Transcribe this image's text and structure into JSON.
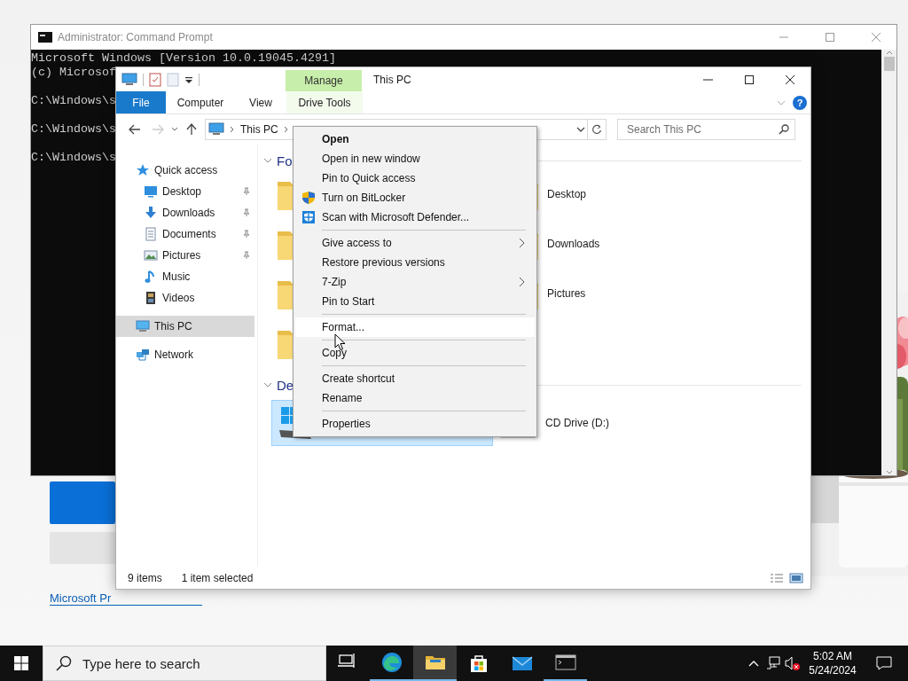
{
  "background_app": {
    "link": "Microsoft Pr"
  },
  "command_prompt": {
    "title": "Administrator: Command Prompt",
    "lines": [
      {
        "text": "Microsoft Windows [Version 10.0.19045.4291]",
        "blank_before": false
      },
      {
        "text": "(c) Microsof",
        "blank_before": false
      },
      {
        "text": "C:\\Windows\\s",
        "blank_before": true
      },
      {
        "text": "C:\\Windows\\s",
        "blank_before": true
      },
      {
        "text": "C:\\Windows\\s",
        "blank_before": true
      }
    ]
  },
  "explorer": {
    "context_tab": "Manage",
    "title": "This PC",
    "help": "?",
    "ribbon_tabs": [
      {
        "label": "File",
        "kind": "file"
      },
      {
        "label": "Computer",
        "kind": "tab"
      },
      {
        "label": "View",
        "kind": "tab"
      },
      {
        "label": "Drive Tools",
        "kind": "contextual"
      }
    ],
    "address": {
      "crumbs": [
        "This PC"
      ]
    },
    "search": {
      "placeholder": "Search This PC"
    },
    "navigation": [
      {
        "label": "Quick access",
        "selected": false,
        "children": [
          {
            "label": "Desktop",
            "pinned": true,
            "selected": false
          },
          {
            "label": "Downloads",
            "pinned": true,
            "selected": false
          },
          {
            "label": "Documents",
            "pinned": true,
            "selected": false
          },
          {
            "label": "Pictures",
            "pinned": true,
            "selected": false
          },
          {
            "label": "Music",
            "pinned": false,
            "selected": false
          },
          {
            "label": "Videos",
            "pinned": false,
            "selected": false
          }
        ]
      },
      {
        "label": "This PC",
        "selected": true
      },
      {
        "label": "Network",
        "selected": false
      }
    ],
    "groups": [
      {
        "header": "Fo",
        "expanded": true,
        "items": [
          {
            "kind": "folder",
            "selected": false
          },
          {
            "kind": "folder",
            "label": "Desktop",
            "selected": false
          },
          {
            "kind": "folder",
            "selected": false
          },
          {
            "kind": "folder",
            "label": "Downloads",
            "selected": false
          },
          {
            "kind": "folder",
            "selected": false
          },
          {
            "kind": "folder",
            "label": "Pictures",
            "selected": false
          },
          {
            "kind": "folder",
            "selected": false
          }
        ]
      },
      {
        "header": "De",
        "expanded": true,
        "items": [
          {
            "kind": "drive",
            "selected": true
          },
          {
            "kind": "drive",
            "label": "CD Drive (D:)",
            "selected": false
          }
        ]
      }
    ],
    "status_bar": {
      "item_count": "9 items",
      "selection": "1 item selected"
    }
  },
  "context_menu": {
    "sections": [
      [
        {
          "label": "Open",
          "default": true,
          "submenu": false,
          "hovered": false
        },
        {
          "label": "Open in new window",
          "default": false,
          "submenu": false,
          "hovered": false
        },
        {
          "label": "Pin to Quick access",
          "default": false,
          "submenu": false,
          "hovered": false
        },
        {
          "label": "Turn on BitLocker",
          "default": false,
          "submenu": false,
          "hovered": false
        },
        {
          "label": "Scan with Microsoft Defender...",
          "default": false,
          "submenu": false,
          "hovered": false
        }
      ],
      [
        {
          "label": "Give access to",
          "default": false,
          "submenu": true,
          "hovered": false
        },
        {
          "label": "Restore previous versions",
          "default": false,
          "submenu": false,
          "hovered": false
        },
        {
          "label": "7-Zip",
          "default": false,
          "submenu": true,
          "hovered": false
        },
        {
          "label": "Pin to Start",
          "default": false,
          "submenu": false,
          "hovered": false
        }
      ],
      [
        {
          "label": "Format...",
          "default": false,
          "submenu": false,
          "hovered": true
        }
      ],
      [
        {
          "label": "Copy",
          "default": false,
          "submenu": false,
          "hovered": false
        }
      ],
      [
        {
          "label": "Create shortcut",
          "default": false,
          "submenu": false,
          "hovered": false
        },
        {
          "label": "Rename",
          "default": false,
          "submenu": false,
          "hovered": false
        }
      ],
      [
        {
          "label": "Properties",
          "default": false,
          "submenu": false,
          "hovered": false
        }
      ]
    ]
  },
  "taskbar": {
    "search": {
      "placeholder": "Type here to search"
    },
    "apps": [
      {
        "running": false,
        "active": false
      },
      {
        "running": true,
        "active": false
      },
      {
        "running": true,
        "active": true
      },
      {
        "running": false,
        "active": false
      },
      {
        "running": false,
        "active": false
      },
      {
        "running": true,
        "active": false
      }
    ],
    "clock": {
      "time": "5:02 AM",
      "date": "5/24/2024"
    }
  }
}
